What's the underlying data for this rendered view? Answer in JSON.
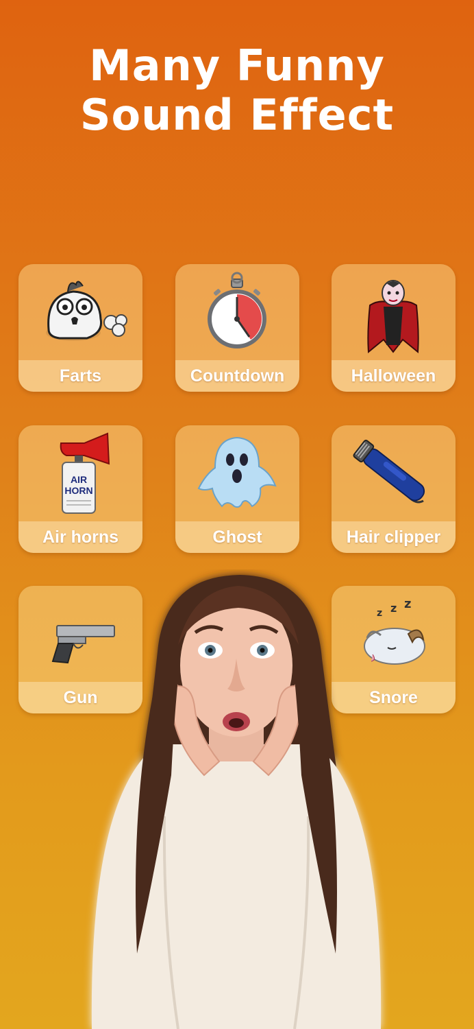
{
  "headline": {
    "line1": "Many Funny",
    "line2": "Sound Effect"
  },
  "tiles": [
    {
      "label": "Farts",
      "icon": "chick-fart-icon"
    },
    {
      "label": "Countdown",
      "icon": "stopwatch-icon"
    },
    {
      "label": "Halloween",
      "icon": "vampire-icon"
    },
    {
      "label": "Air horns",
      "icon": "air-horn-icon"
    },
    {
      "label": "Ghost",
      "icon": "ghost-icon"
    },
    {
      "label": "Hair clipper",
      "icon": "hair-clipper-icon"
    },
    {
      "label": "Gun",
      "icon": "pistol-icon"
    },
    {
      "label": "Snore",
      "icon": "sleeping-creature-icon"
    }
  ],
  "colors": {
    "bg_top": "#df6310",
    "bg_bottom": "#e3a61e",
    "text": "#ffffff"
  },
  "airhorn_can": {
    "line1": "AIR",
    "line2": "HORN"
  }
}
